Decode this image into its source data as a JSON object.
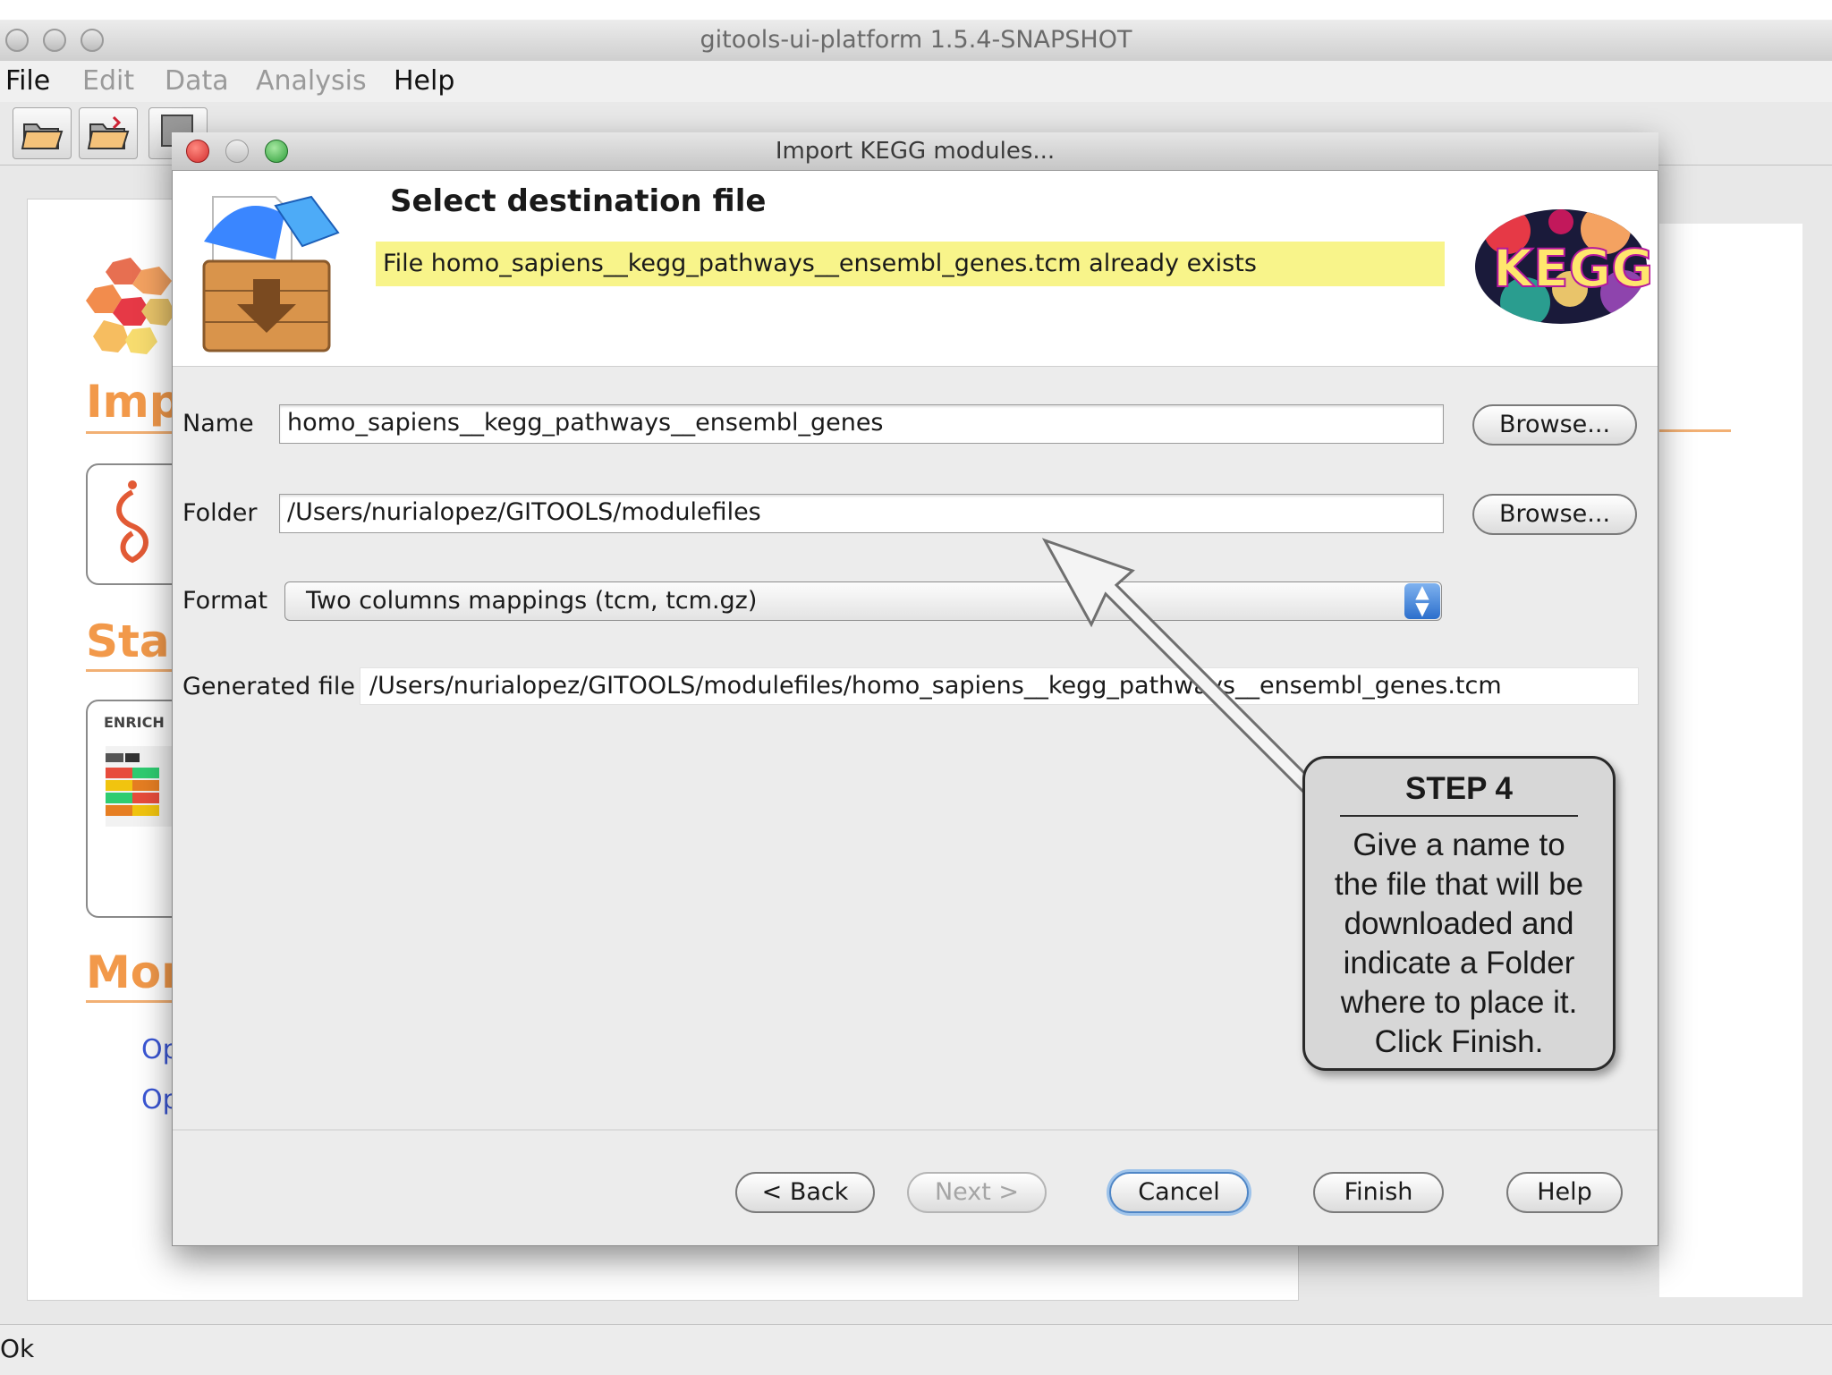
{
  "app": {
    "title": "gitools-ui-platform 1.5.4-SNAPSHOT",
    "menu": [
      "File",
      "Edit",
      "Data",
      "Analysis",
      "Help"
    ],
    "status": "Ok",
    "background_sections": {
      "import_head": "Imp",
      "start_head": "Star",
      "more_head": "Mor",
      "card_label": "ENRICH",
      "links": [
        "Op",
        "Op"
      ]
    }
  },
  "dialog": {
    "title": "Import KEGG modules...",
    "heading": "Select destination file",
    "warning": "File homo_sapiens__kegg_pathways__ensembl_genes.tcm already exists",
    "logo_text": "KEGG",
    "fields": {
      "name_label": "Name",
      "name_value": "homo_sapiens__kegg_pathways__ensembl_genes",
      "folder_label": "Folder",
      "folder_value": "/Users/nurialopez/GITOOLS/modulefiles",
      "format_label": "Format",
      "format_value": "Two columns mappings (tcm, tcm.gz)",
      "generated_label": "Generated file",
      "generated_value": "/Users/nurialopez/GITOOLS/modulefiles/homo_sapiens__kegg_pathways__ensembl_genes.tcm"
    },
    "browse_label": "Browse...",
    "buttons": {
      "back": "< Back",
      "next": "Next >",
      "cancel": "Cancel",
      "finish": "Finish",
      "help": "Help"
    }
  },
  "callout": {
    "title": "STEP 4",
    "lines": [
      "Give a name to",
      "the file that will be",
      "downloaded and",
      "indicate a Folder",
      "where to place it.",
      "Click Finish."
    ]
  },
  "colors": {
    "accent_orange": "#f2994a",
    "warning_yellow": "#f8f48a",
    "link_blue": "#3b57d6",
    "close_red": "#e0443e",
    "min_yellow": "#d8d8d8",
    "zoom_green": "#3fb950"
  }
}
